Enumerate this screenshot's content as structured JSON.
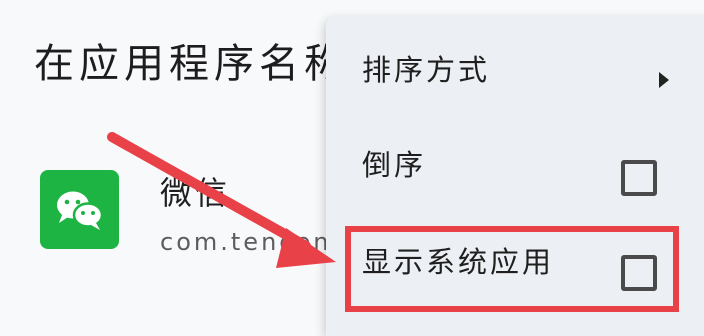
{
  "header": {
    "title": "在应用程序名称"
  },
  "app": {
    "name": "微信",
    "package": "com.tencent.mm",
    "icon": "wechat-icon",
    "icon_color": "#1eb444"
  },
  "menu": {
    "items": [
      {
        "label": "排序方式",
        "control": "submenu-arrow"
      },
      {
        "label": "倒序",
        "control": "checkbox",
        "checked": false
      },
      {
        "label": "显示系统应用",
        "control": "checkbox",
        "checked": false
      }
    ]
  },
  "annotation": {
    "color": "#e94148",
    "arrow_icon": "arrow-icon"
  }
}
